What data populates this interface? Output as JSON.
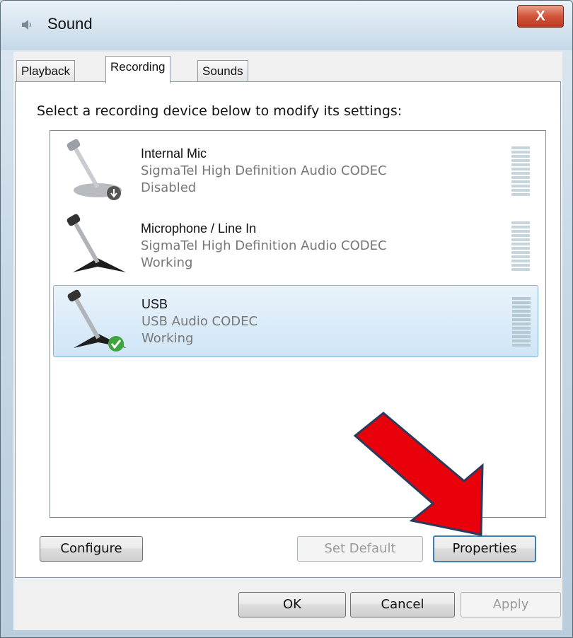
{
  "window": {
    "title": "Sound",
    "close_label": "X"
  },
  "tabs": [
    {
      "label": "Playback"
    },
    {
      "label": "Recording"
    },
    {
      "label": "Sounds"
    }
  ],
  "recording": {
    "instruction": "Select a recording device below to modify its settings:",
    "devices": [
      {
        "name": "Internal Mic",
        "description": "SigmaTel High Definition Audio CODEC",
        "status": "Disabled",
        "badge": "down-arrow-icon"
      },
      {
        "name": "Microphone / Line In",
        "description": "SigmaTel High Definition Audio CODEC",
        "status": "Working",
        "badge": ""
      },
      {
        "name": "USB",
        "description": "USB Audio CODEC",
        "status": "Working",
        "badge": "checkmark-icon"
      }
    ],
    "selected_device": "USB",
    "configure_label": "Configure",
    "set_default_label": "Set Default",
    "properties_label": "Properties"
  },
  "dialog_buttons": {
    "ok": "OK",
    "cancel": "Cancel",
    "apply": "Apply"
  },
  "colors": {
    "selection": "#cfe5f6",
    "annotation_arrow": "#e8000a",
    "close_button": "#d2553b"
  }
}
